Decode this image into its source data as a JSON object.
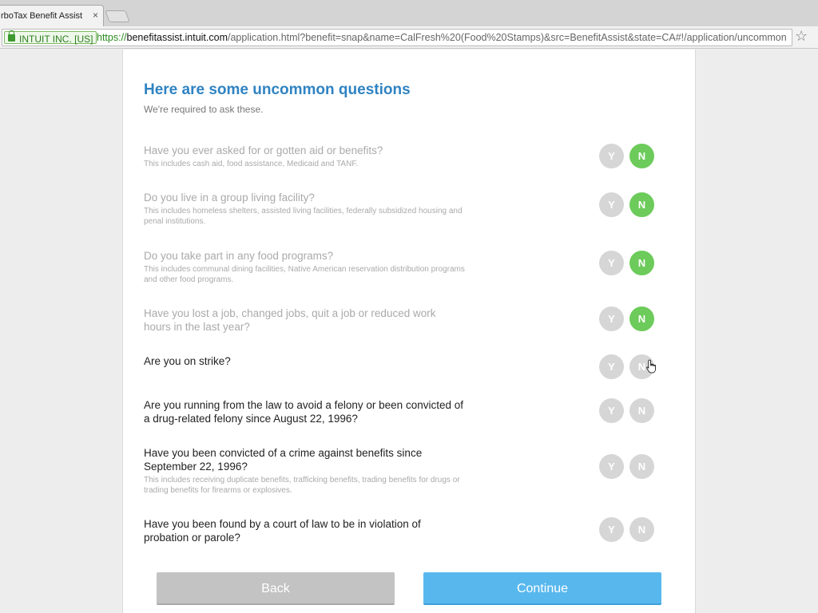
{
  "browser": {
    "tab_title": "rboTax Benefit Assist",
    "tab_close": "×",
    "ev_label": "INTUIT INC. [US]",
    "url_scheme": "https://",
    "url_host": "benefitassist.intuit.com",
    "url_path": "/application.html?benefit=snap&name=CalFresh%20(Food%20Stamps)&src=BenefitAssist&state=CA#!/application/uncommon",
    "bookmark_star": "☆"
  },
  "page": {
    "title": "Here are some uncommon questions",
    "subtitle": "We're required to ask these."
  },
  "questions": [
    {
      "text": "Have you ever asked for or gotten aid or benefits?",
      "note": "This includes cash aid, food assistance, Medicaid and TANF.",
      "answer": "N"
    },
    {
      "text": "Do you live in a group living facility?",
      "note": "This includes homeless shelters, assisted living facilities, federally subsidized housing and penal institutions.",
      "answer": "N"
    },
    {
      "text": "Do you take part in any food programs?",
      "note": "This includes communal dining facilities, Native American reservation distribution programs and other food programs.",
      "answer": "N"
    },
    {
      "text": "Have you lost a job, changed jobs, quit a job or reduced work hours in the last year?",
      "note": "",
      "answer": "N"
    },
    {
      "text": "Are you on strike?",
      "note": "",
      "answer": ""
    },
    {
      "text": "Are you running from the law to avoid a felony or been convicted of a drug-related felony since August 22, 1996?",
      "note": "",
      "answer": ""
    },
    {
      "text": "Have you been convicted of a crime against benefits since September 22, 1996?",
      "note": "This includes receiving duplicate benefits, trafficking benefits, trading benefits for drugs or trading benefits for firearms or explosives.",
      "answer": ""
    },
    {
      "text": "Have you been found by a court of law to be in violation of probation or parole?",
      "note": "",
      "answer": ""
    }
  ],
  "labels": {
    "yes": "Y",
    "no": "N"
  },
  "actions": {
    "back": "Back",
    "continue": "Continue"
  },
  "colors": {
    "accent": "#2f83c2",
    "selected": "#6ccb5a",
    "unselected": "#d6d6d6",
    "continue": "#58b8ee",
    "back": "#c3c3c3"
  }
}
